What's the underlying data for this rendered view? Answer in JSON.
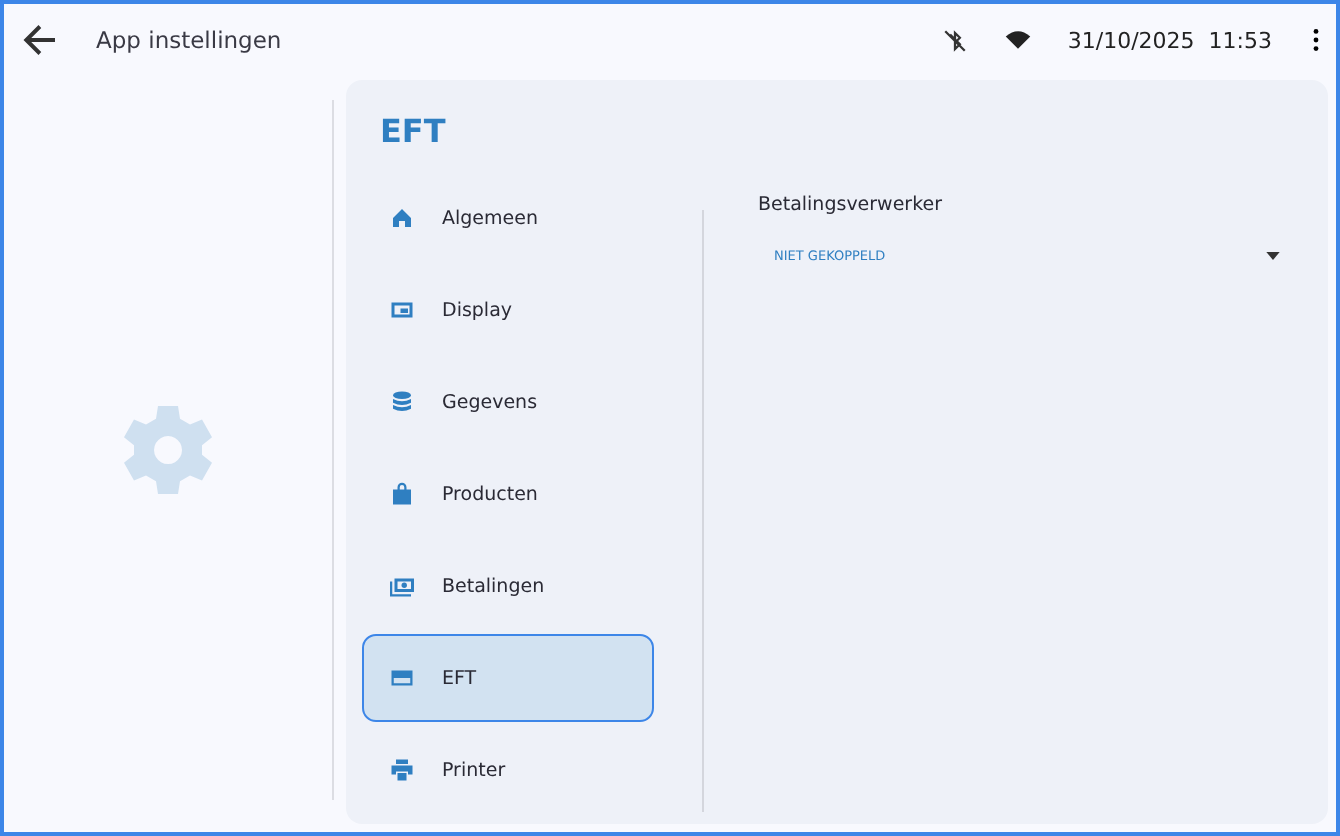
{
  "app_bar": {
    "title": "App instellingen",
    "date": "31/10/2025",
    "time": "11:53"
  },
  "panel": {
    "title": "EFT",
    "nav": [
      {
        "label": "Algemeen",
        "selected": false
      },
      {
        "label": "Display",
        "selected": false
      },
      {
        "label": "Gegevens",
        "selected": false
      },
      {
        "label": "Producten",
        "selected": false
      },
      {
        "label": "Betalingen",
        "selected": false
      },
      {
        "label": "EFT",
        "selected": true
      },
      {
        "label": "Printer",
        "selected": false
      }
    ],
    "setting": {
      "label": "Betalingsverwerker",
      "value": "NIET GEKOPPELD"
    }
  }
}
